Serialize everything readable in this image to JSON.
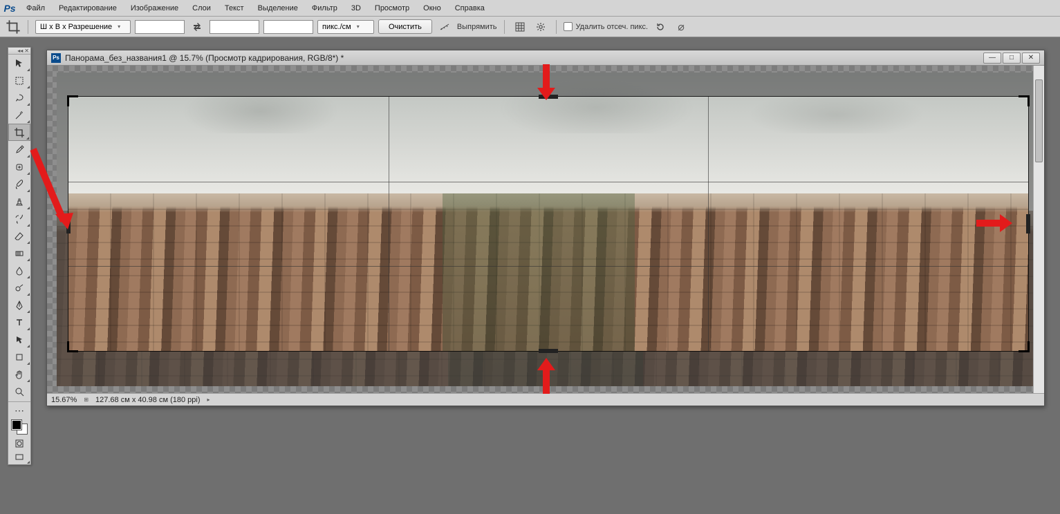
{
  "app": {
    "logo": "Ps"
  },
  "menu": {
    "items": [
      "Файл",
      "Редактирование",
      "Изображение",
      "Слои",
      "Текст",
      "Выделение",
      "Фильтр",
      "3D",
      "Просмотр",
      "Окно",
      "Справка"
    ]
  },
  "options": {
    "ratio_preset": "Ш x В x Разрешение",
    "width": "",
    "height": "",
    "resolution": "",
    "unit": "пикс./см",
    "clear_btn": "Очистить",
    "straighten_btn": "Выпрямить",
    "delete_crop_label": "Удалить отсеч. пикс."
  },
  "document": {
    "title": "Панорама_без_названия1 @ 15.7% (Просмотр кадрирования, RGB/8*) *",
    "zoom": "15.67%",
    "dimensions": "127.68 см x 40.98 см (180 ppi)"
  },
  "tools": [
    "move",
    "rect-marquee",
    "lasso",
    "magic-wand",
    "crop",
    "eyedropper",
    "healing",
    "brush",
    "clone",
    "history-brush",
    "eraser",
    "gradient",
    "blur",
    "dodge",
    "pen",
    "type",
    "path-select",
    "rectangle",
    "hand",
    "zoom"
  ]
}
